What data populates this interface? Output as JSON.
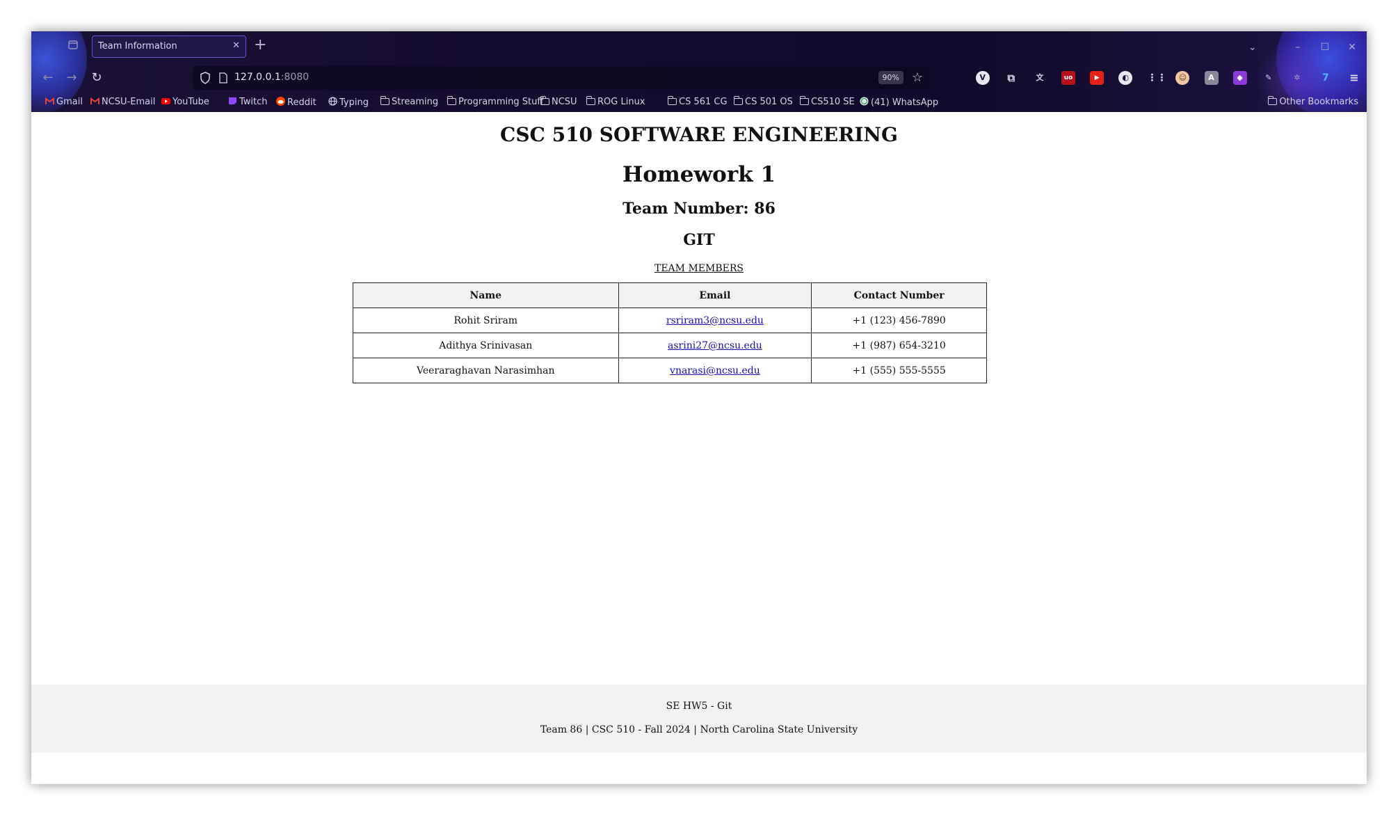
{
  "browser": {
    "tab": {
      "title": "Team Information"
    },
    "url": {
      "host": "127.0.0.1",
      "port": ":8080"
    },
    "zoom": "90%",
    "bookmarks": [
      {
        "label": "Gmail",
        "icon": "gmail-icon"
      },
      {
        "label": "NCSU-Email",
        "icon": "gmail-icon"
      },
      {
        "label": "YouTube",
        "icon": "youtube-icon"
      },
      {
        "label": "Twitch",
        "icon": "twitch-icon"
      },
      {
        "label": "Reddit",
        "icon": "reddit-icon"
      },
      {
        "label": "Typing",
        "icon": "globe-icon"
      },
      {
        "label": "Streaming",
        "icon": "folder-icon"
      },
      {
        "label": "Programming Stuff",
        "icon": "folder-icon"
      },
      {
        "label": "NCSU",
        "icon": "folder-icon"
      },
      {
        "label": "ROG Linux",
        "icon": "folder-icon"
      },
      {
        "label": "CS 561 CG",
        "icon": "folder-icon"
      },
      {
        "label": "CS 501 OS",
        "icon": "folder-icon"
      },
      {
        "label": "CS510 SE",
        "icon": "folder-icon"
      },
      {
        "label": "(41) WhatsApp",
        "icon": "whatsapp-icon"
      }
    ],
    "other_bookmarks": "Other Bookmarks"
  },
  "page": {
    "title": "CSC 510 SOFTWARE ENGINEERING",
    "homework": "Homework 1",
    "team_number": "Team Number: 86",
    "topic": "GIT",
    "members_heading": "TEAM MEMBERS",
    "table": {
      "headers": [
        "Name",
        "Email",
        "Contact Number"
      ],
      "rows": [
        {
          "name": "Rohit Sriram",
          "email": "rsriram3@ncsu.edu",
          "phone": "+1 (123) 456-7890"
        },
        {
          "name": "Adithya Srinivasan",
          "email": "asrini27@ncsu.edu",
          "phone": "+1 (987) 654-3210"
        },
        {
          "name": "Veeraraghavan Narasimhan",
          "email": "vnarasi@ncsu.edu",
          "phone": "+1 (555) 555-5555"
        }
      ]
    },
    "footer": {
      "line1": "SE HW5 - Git",
      "line2": "Team 86 | CSC 510 - Fall 2024 | North Carolina State University"
    }
  },
  "colors": {
    "chrome_bg": "#140c2c",
    "tab_border": "#5f57d8",
    "link": "#1a0dab",
    "table_header_bg": "#f2f2f2",
    "footer_bg": "#f2f2f2"
  }
}
